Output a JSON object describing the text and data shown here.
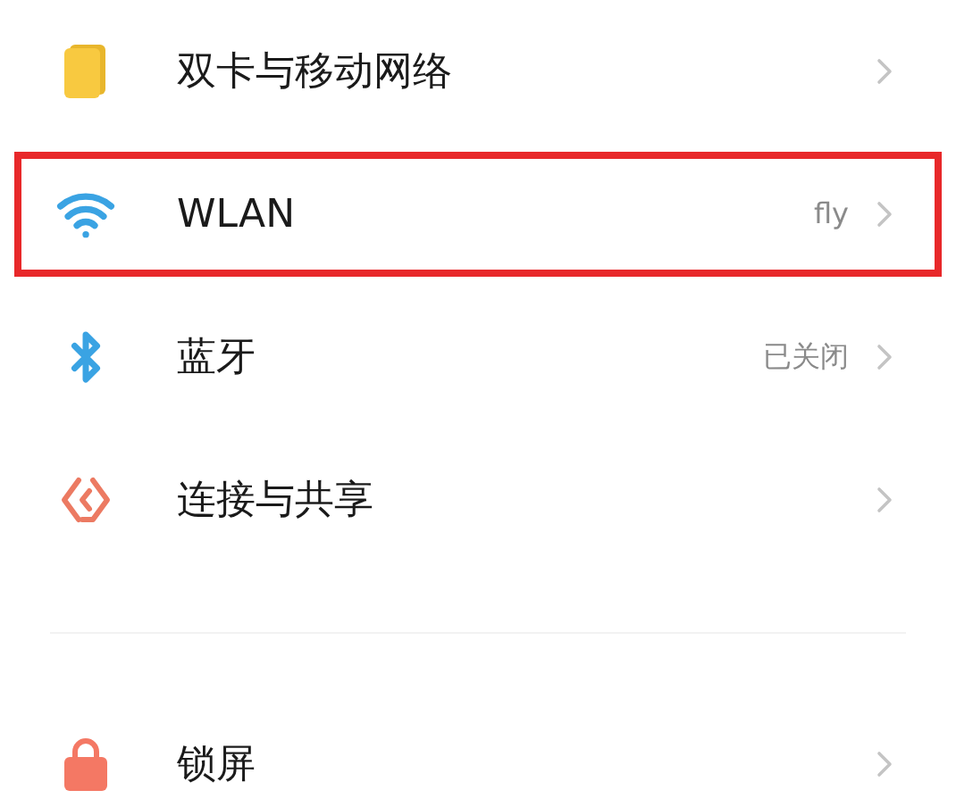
{
  "groups": [
    [
      {
        "kind": "sim",
        "label": "双卡与移动网络",
        "highlighted": false
      },
      {
        "kind": "wifi",
        "label": "WLAN",
        "value": "fly",
        "highlighted": true
      },
      {
        "kind": "bluetooth",
        "label": "蓝牙",
        "value": "已关闭",
        "highlighted": false
      },
      {
        "kind": "share",
        "label": "连接与共享",
        "highlighted": false
      }
    ],
    [
      {
        "kind": "lock",
        "label": "锁屏",
        "highlighted": false
      }
    ]
  ]
}
